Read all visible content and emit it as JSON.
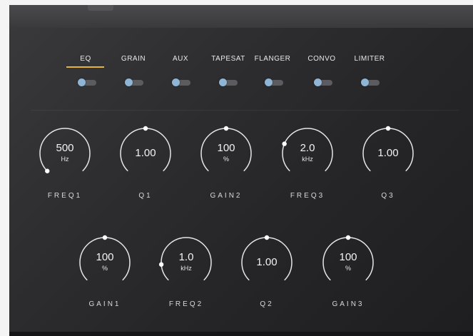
{
  "tabs": [
    {
      "label": "EQ",
      "active": true
    },
    {
      "label": "GRAIN",
      "active": false
    },
    {
      "label": "AUX",
      "active": false
    },
    {
      "label": "TAPESAT",
      "active": false
    },
    {
      "label": "FLANGER",
      "active": false
    },
    {
      "label": "CONVO",
      "active": false
    },
    {
      "label": "LIMITER",
      "active": false
    }
  ],
  "toggles": [
    {
      "on": false
    },
    {
      "on": false
    },
    {
      "on": false
    },
    {
      "on": false
    },
    {
      "on": false
    },
    {
      "on": false
    },
    {
      "on": false
    }
  ],
  "knobs": [
    {
      "value": "500",
      "unit": "Hz",
      "label": "FREQ1",
      "level": 0.0
    },
    {
      "value": "1.00",
      "unit": "",
      "label": "Q1",
      "level": 0.5
    },
    {
      "value": "100",
      "unit": "%",
      "label": "GAIN2",
      "level": 0.5
    },
    {
      "value": "2.0",
      "unit": "kHz",
      "label": "FREQ3",
      "level": 0.25
    },
    {
      "value": "1.00",
      "unit": "",
      "label": "Q3",
      "level": 0.5
    },
    {
      "value": "100",
      "unit": "%",
      "label": "GAIN1",
      "level": 0.5
    },
    {
      "value": "1.0",
      "unit": "kHz",
      "label": "FREQ2",
      "level": 0.15
    },
    {
      "value": "1.00",
      "unit": "",
      "label": "Q2",
      "level": 0.5
    },
    {
      "value": "100",
      "unit": "%",
      "label": "GAIN3",
      "level": 0.5
    }
  ],
  "colors": {
    "accent": "#e8b33a",
    "knob_arc": "#e6e6e6",
    "toggle_knob": "#8fb4d4",
    "toggle_track": "#5c5c60"
  }
}
